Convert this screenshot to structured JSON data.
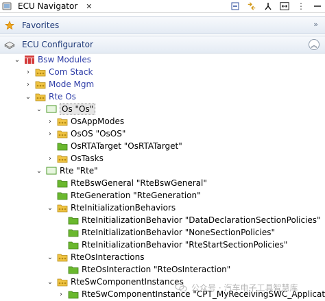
{
  "window": {
    "title": "ECU Navigator"
  },
  "sections": {
    "favorites": {
      "label": "Favorites"
    },
    "configurator": {
      "label": "ECU Configurator"
    }
  },
  "tree": [
    {
      "text": "Bsw Modules",
      "type": "modules",
      "expanded": true,
      "color": "blue"
    },
    {
      "text": "Com Stack",
      "type": "folder",
      "expanded": false,
      "color": "blue"
    },
    {
      "text": "Mode Mgm",
      "type": "folder",
      "expanded": false,
      "color": "blue"
    },
    {
      "text": "Rte Os",
      "type": "folder",
      "expanded": true,
      "color": "blue"
    },
    {
      "text": "Os \"Os\"",
      "type": "module",
      "expanded": true,
      "selected": true
    },
    {
      "text": "OsAppModes",
      "type": "folder",
      "expanded": false
    },
    {
      "text": "OsOS \"OsOS\"",
      "type": "folder",
      "expanded": false
    },
    {
      "text": "OsRTATarget \"OsRTATarget\"",
      "type": "container"
    },
    {
      "text": "OsTasks",
      "type": "folder",
      "expanded": false
    },
    {
      "text": "Rte \"Rte\"",
      "type": "module",
      "expanded": true
    },
    {
      "text": "RteBswGeneral \"RteBswGeneral\"",
      "type": "container"
    },
    {
      "text": "RteGeneration \"RteGeneration\"",
      "type": "container"
    },
    {
      "text": "RteInitializationBehaviors",
      "type": "folder",
      "expanded": true
    },
    {
      "text": "RteInitializationBehavior \"DataDeclarationSectionPolicies\"",
      "type": "container"
    },
    {
      "text": "RteInitializationBehavior \"NoneSectionPolicies\"",
      "type": "container"
    },
    {
      "text": "RteInitializationBehavior \"RteStartSectionPolicies\"",
      "type": "container"
    },
    {
      "text": "RteOsInteractions",
      "type": "folder",
      "expanded": true
    },
    {
      "text": "RteOsInteraction \"RteOsInteraction\"",
      "type": "container"
    },
    {
      "text": "RteSwComponentInstances",
      "type": "folder",
      "expanded": true
    },
    {
      "text": "RteSwComponentInstance \"CPT_MyReceivingSWC_Applicatio",
      "type": "container",
      "expanded": false
    }
  ],
  "watermark": {
    "text": "公众号 · 汽车电子工具智慧库"
  },
  "colors": {
    "accent": "#2f3ea8",
    "folder": "#f0c443",
    "container": "#6ab82e"
  }
}
